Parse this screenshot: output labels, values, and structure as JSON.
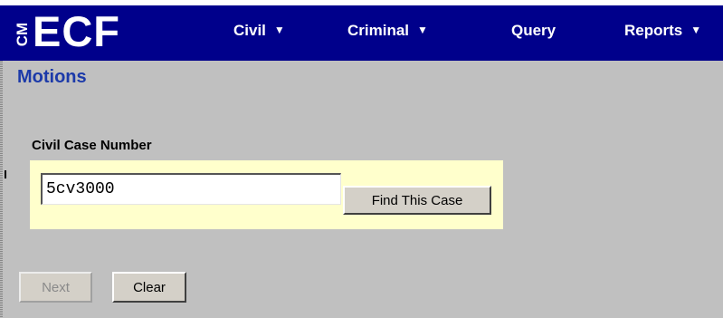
{
  "header": {
    "logo_prefix": "CM",
    "logo_text": "ECF",
    "menus": [
      {
        "label": "Civil",
        "has_dropdown": true
      },
      {
        "label": "Criminal",
        "has_dropdown": true
      },
      {
        "label": "Query",
        "has_dropdown": false
      },
      {
        "label": "Reports",
        "has_dropdown": true
      }
    ]
  },
  "page": {
    "title": "Motions"
  },
  "form": {
    "case_number_label": "Civil Case Number",
    "case_number_value": "5cv3000",
    "find_button_label": "Find This Case"
  },
  "actions": {
    "next_label": "Next",
    "clear_label": "Clear"
  },
  "colors": {
    "navbar": "#00008b",
    "title": "#1c3aa9",
    "panel": "#ffffcc",
    "background": "#c0c0c0"
  }
}
